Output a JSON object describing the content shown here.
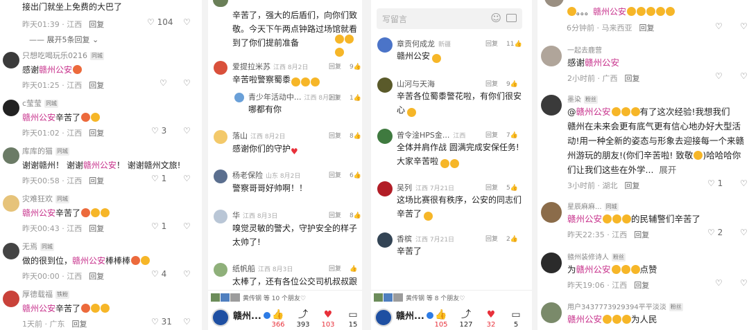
{
  "colors": {
    "highlight": "#c7308b",
    "like_red": "#e8303a",
    "name_gray": "#8a8a8a"
  },
  "p1": {
    "top_text": "接出门就坐上免费的大巴了",
    "top_meta": {
      "time": "昨天01:39",
      "loc": "江西",
      "reply": "回复",
      "likes": "104"
    },
    "expand": "展开5条回复",
    "comments": [
      {
        "name": "只想吃喝玩乐0216",
        "tag": "同城",
        "pre": "感谢",
        "hl": "赣州公安",
        "post": "",
        "emoji": 1,
        "time": "昨天01:25",
        "loc": "江西",
        "reply": "回复",
        "likes": ""
      },
      {
        "name": "c莹莹",
        "tag": "同城",
        "pre": "",
        "hl": "赣州公安",
        "post": "辛苦了",
        "emoji": 2,
        "time": "昨天01:02",
        "loc": "江西",
        "reply": "回复",
        "likes": "3"
      },
      {
        "name": "库库的猫",
        "tag": "同城",
        "pre": "谢谢赣州！ 谢谢",
        "hl": "赣州公安",
        "post": "！ 谢谢赣州文旅!",
        "emoji": 0,
        "time": "昨天00:58",
        "loc": "江西",
        "reply": "回复",
        "likes": "1"
      },
      {
        "name": "灾难狂欢",
        "tag": "同城",
        "pre": "",
        "hl": "赣州公安",
        "post": "辛苦了",
        "emoji": 3,
        "time": "昨天00:43",
        "loc": "江西",
        "reply": "回复",
        "likes": "1"
      },
      {
        "name": "无焉",
        "tag": "同城",
        "pre": "做的很到位，",
        "hl": "赣州公安",
        "post": "棒棒棒",
        "emoji": 2,
        "time": "昨天00:00",
        "loc": "江西",
        "reply": "回复",
        "likes": "4"
      },
      {
        "name": "厚德载福",
        "tag": "铁粉",
        "pre": "",
        "hl": "赣州公安",
        "post": "辛苦了",
        "emoji": 3,
        "time": "1天前",
        "loc": "广东",
        "reply": "回复",
        "likes": "31"
      }
    ]
  },
  "p2": {
    "top_lines": [
      "辛苦了，强大的后盾们，向你们致",
      "敬。今天下午两点钟路过场馆就看",
      "到了你们提前准备"
    ],
    "comments": [
      {
        "name": "爱提拉米苏",
        "date": "江西 8月2日",
        "reply": "回复",
        "likes": "9",
        "lines": [
          "辛苦啦警察蜀黍"
        ],
        "emoji": 3,
        "sub": {
          "name": "青少年活动中...",
          "date": "江西 8月2日",
          "reply": "回复",
          "likes": "1",
          "text": "哪都有你"
        }
      },
      {
        "name": "落山",
        "date": "江西 8月2日",
        "reply": "回复",
        "likes": "8",
        "lines": [
          "感谢你们的守护"
        ],
        "emoji": 0
      },
      {
        "name": "杨老保险",
        "date": "山东 8月2日",
        "reply": "回复",
        "likes": "6",
        "lines": [
          "警察哥哥好帅啊！！"
        ],
        "emoji": 0
      },
      {
        "name": "华",
        "date": "江西 8月3日",
        "reply": "回复",
        "likes": "8",
        "lines": [
          "嗅觉灵敏的警犬，守护安全的样子",
          "太帅了!"
        ],
        "emoji": 0
      },
      {
        "name": "纸帆船",
        "date": "江西 8月3日",
        "reply": "回复",
        "likes": "",
        "lines": [
          "太棒了，还有各位公交司机叔叔跟"
        ],
        "emoji": 0
      }
    ],
    "bar": {
      "friends": "黄传钢 等 10 个朋友",
      "brand": "赣州...",
      "likes": "366",
      "shares": "393",
      "hearts": "103",
      "comments": "15"
    }
  },
  "p3": {
    "input_placeholder": "写留言",
    "comments": [
      {
        "name": "章贡何成龙",
        "badge": "新疆",
        "reply": "回复",
        "likes": "11",
        "lines": [
          "赣州公安"
        ],
        "emoji": 1
      },
      {
        "name": "山河与天海",
        "badge": "",
        "reply": "回复",
        "likes": "9",
        "lines": [
          "辛苦各位蜀黍警花啦，有你们很安",
          "心"
        ],
        "emoji": 1
      },
      {
        "name": "曾令淦HPS金...",
        "badge": "江西",
        "reply": "回复",
        "likes": "7",
        "lines": [
          "全体并肩作战 圆满完成安保任务!",
          "大家辛苦啦"
        ],
        "emoji": 2
      },
      {
        "name": "吴列",
        "badge": "江西 7月21日",
        "reply": "回复",
        "likes": "5",
        "lines": [
          "这场比赛很有秩序，公安的同志们",
          "辛苦了"
        ],
        "emoji": 1
      },
      {
        "name": "香槟",
        "badge": "江西 7月21日",
        "reply": "回复",
        "likes": "2",
        "lines": [
          "辛苦了"
        ],
        "emoji": 0
      }
    ],
    "bar": {
      "friends": "黄传钢 等 8 个朋友",
      "brand": "赣州...",
      "likes": "105",
      "shares": "127",
      "hearts": "32",
      "comments": "5"
    }
  },
  "p4": {
    "top_text": "。。。",
    "top_hl": "赣州公安",
    "top_meta": {
      "time": "6分钟前",
      "loc": "马来西亚",
      "reply": "回复"
    },
    "comments": [
      {
        "name": "一起去鹿营",
        "tag": "",
        "lines": [
          {
            "pre": "感谢",
            "hl": "赣州公安",
            "post": ""
          }
        ],
        "time": "2小时前",
        "loc": "广西",
        "reply": "回复",
        "likes": ""
      },
      {
        "name": "墨染",
        "tag": "粉丝",
        "lines": [
          {
            "pre": "@",
            "hl": "赣州公安",
            "post": "有了这次经验!我想我们"
          },
          {
            "pre": "赣州在未来会更有底气更有信心地办好大型活",
            "hl": "",
            "post": ""
          },
          {
            "pre": "动!用一种全新的姿态与形象去迎接每一个来赣",
            "hl": "",
            "post": ""
          },
          {
            "pre": "州游玩的朋友!(你们辛苦啦!  致敬",
            "hl": "",
            "post": ")哈哈哈你"
          },
          {
            "pre": "们让我们这些在外学...",
            "hl": "",
            "post": "展开"
          }
        ],
        "time": "3小时前",
        "loc": "湖北",
        "reply": "回复",
        "likes": "1"
      },
      {
        "name": "星辰麻麻...",
        "tag": "同城",
        "lines": [
          {
            "pre": "",
            "hl": "赣州公安",
            "post": "的民辅警们辛苦了"
          }
        ],
        "time": "昨天22:35",
        "loc": "江西",
        "reply": "回复",
        "likes": "2"
      },
      {
        "name": "赣州装修诗人",
        "tag": "粉丝",
        "lines": [
          {
            "pre": "为",
            "hl": "赣州公安",
            "post": "点赞"
          }
        ],
        "time": "昨天19:06",
        "loc": "江西",
        "reply": "回复",
        "likes": ""
      },
      {
        "name": "用户3437773929394平平淡淡",
        "tag": "粉丝",
        "lines": [
          {
            "pre": "",
            "hl": "赣州公安",
            "post": "为人民"
          }
        ],
        "time": "",
        "loc": "",
        "reply": "",
        "likes": ""
      }
    ]
  }
}
